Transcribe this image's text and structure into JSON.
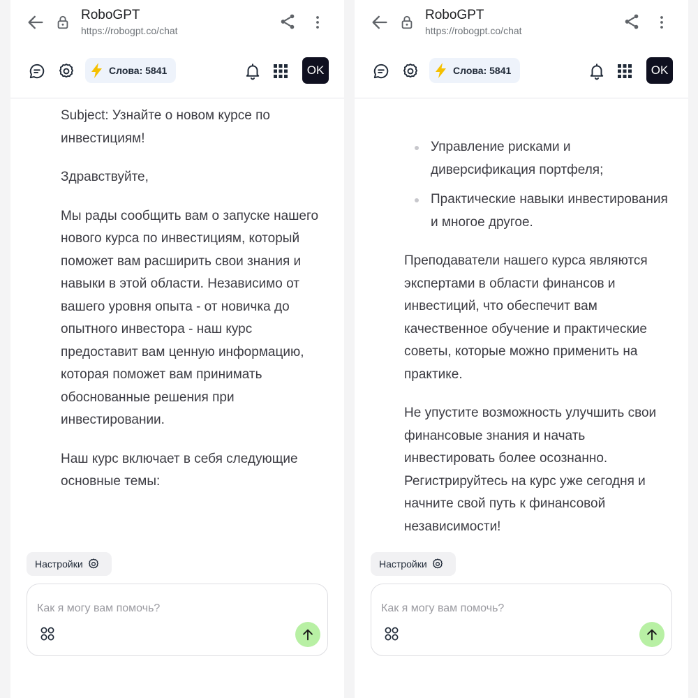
{
  "browser": {
    "title": "RoboGPT",
    "url": "https://robogpt.co/chat"
  },
  "app_bar": {
    "words_label": "Слова: 5841",
    "ok_label": "OK"
  },
  "composer": {
    "settings_label": "Настройки",
    "placeholder": "Как я могу вам помочь?"
  },
  "colors": {
    "accent_bolt": "#f5c000",
    "send_button": "#b8f0a4",
    "ok_button": "#0f1020"
  },
  "left": {
    "paragraphs": [
      "Subject: Узнайте о новом курсе по инвестициям!",
      "Здравствуйте,",
      "Мы рады сообщить вам о запуске нашего нового курса по инвестициям, который поможет вам расширить свои знания и навыки в этой области. Независимо от вашего уровня опыта - от новичка до опытного инвестора - наш курс предоставит вам ценную информацию, которая поможет вам принимать обоснованные решения при инвестировании.",
      "Наш курс включает в себя следующие основные темы:"
    ]
  },
  "right": {
    "bullets": [
      "Управление рисками и диверсификация портфеля;",
      "Практические навыки инвестирования и многое другое."
    ],
    "paragraphs": [
      "Преподаватели нашего курса являются экспертами в области финансов и инвестиций, что обеспечит вам качественное обучение и практические советы, которые можно применить на практике.",
      "Не упустите возможность улучшить свои финансовые знания и начать инвестировать более осознанно. Регистрируйтесь на курс уже сегодня и начните свой путь к финансовой независимости!"
    ]
  }
}
